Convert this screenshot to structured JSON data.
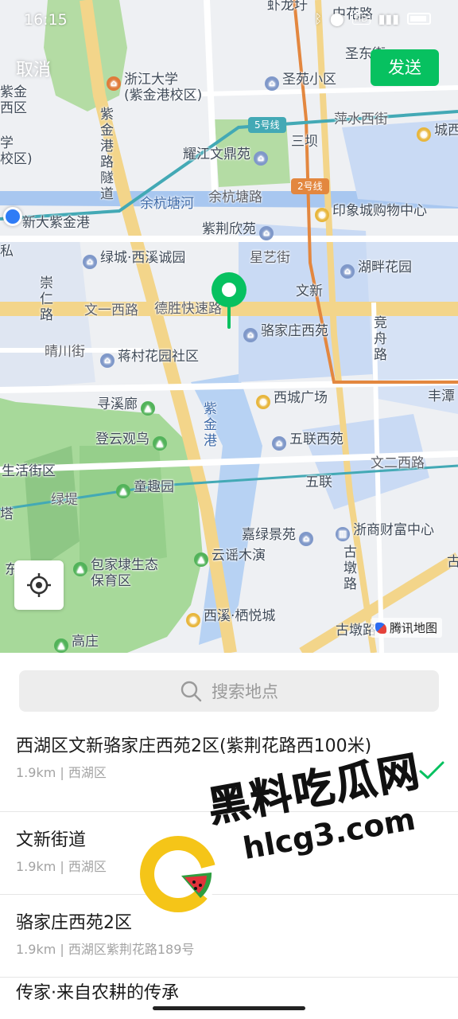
{
  "status_bar": {
    "time": "16:15",
    "icons": [
      "bluetooth-icon",
      "location-icon",
      "hd-icon",
      "signal-icon",
      "battery-icon"
    ],
    "hd_label": "HD"
  },
  "header": {
    "cancel_label": "取消",
    "send_label": "发送"
  },
  "colors": {
    "accent": "#07c160",
    "water": "#a8c7f0",
    "park": "#a7d99a",
    "highway": "#f3d58a",
    "metro_line_2": "#e3873f",
    "metro_line_5": "#43a9b5"
  },
  "map": {
    "labels": {
      "xiamengcun": "虾龙圩",
      "zhonghua": "中花路",
      "shengdongjie": "圣东街",
      "zjdx": "浙江大学\n(紫金港校区)",
      "zijin_west": "紫金\n西区",
      "xue": "学\n校区)",
      "shengyuan": "圣苑小区",
      "pingshui": "萍水西街",
      "chengxi": "城西",
      "yaojiang": "耀江文鼎苑",
      "sanba": "三坝",
      "zijingang_tunnel": "紫金港路隧道",
      "yuhang_tanghe": "余杭塘河",
      "yuhang_tanglu": "余杭塘路",
      "yinxiangcheng": "印象城购物中心",
      "xinda": "新大紫金港",
      "zijing_xinyuan": "紫荆欣苑",
      "xingyi": "星艺街",
      "lvcheng": "绿城·西溪诚园",
      "hupan": "湖畔花园",
      "wenxin": "文新",
      "wenyi_west": "文一西路",
      "desheng": "德胜快速路",
      "chongren": "崇仁路",
      "luojiazhuang": "骆家庄西苑",
      "jingzhou": "竞舟路",
      "qingchuan": "晴川街",
      "jiangcun": "蒋村花园社区",
      "fengtan": "丰潭",
      "xunxi": "寻溪廊",
      "xicheng": "西城广场",
      "zijingang_river": "紫金港",
      "dengyun": "登云观鸟",
      "wulian_xiyuan": "五联西苑",
      "shenghuo": "生活街区",
      "wenersilu": "文二西路",
      "wulian": "五联",
      "tongqu": "童趣园",
      "lvdi": "绿堤",
      "ta": "塔",
      "jialvjing": "嘉绿景苑",
      "zheshang": "浙商财富中心",
      "gudun": "古墩路",
      "baojia": "包家埭生态\n保育区",
      "yunyao": "云谣木演",
      "xixi_qiyue": "西溪·栖悦城",
      "gaozhuang": "高庄",
      "gudun_lu": "古墩路",
      "dong": "东",
      "gu": "古",
      "si": "私"
    },
    "metro_badges": {
      "line5": "5号线",
      "line2": "2号线"
    },
    "brand_label": "腾讯地图"
  },
  "search": {
    "placeholder": "搜索地点"
  },
  "results": [
    {
      "title": "西湖区文新骆家庄西苑2区(紫荆花路西100米)",
      "subtitle": "1.9km | 西湖区",
      "selected": true
    },
    {
      "title": "文新街道",
      "subtitle": "1.9km | 西湖区",
      "selected": false
    },
    {
      "title": "骆家庄西苑2区",
      "subtitle": "1.9km | 西湖区紫荆花路189号",
      "selected": false
    },
    {
      "title": "传家·来自农耕的传承",
      "subtitle": "",
      "selected": false
    }
  ],
  "watermark": {
    "title": "黑料吃瓜网",
    "url": "hlcg3.com"
  }
}
